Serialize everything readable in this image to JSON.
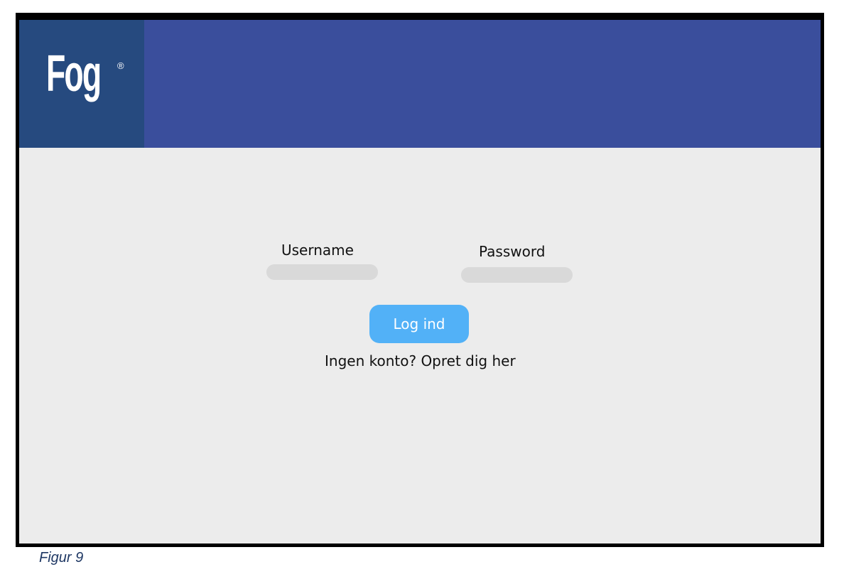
{
  "header": {
    "logo": "Fog",
    "logo_mark": "®",
    "brand_color": "#3a4e9c",
    "logo_bg_color": "#264a7f"
  },
  "login": {
    "username_label": "Username",
    "username_value": "",
    "password_label": "Password",
    "password_value": "",
    "submit_label": "Log ind",
    "submit_color": "#52b1f7",
    "signup_link": "Ingen konto? Opret dig her"
  },
  "caption": "Figur 9"
}
